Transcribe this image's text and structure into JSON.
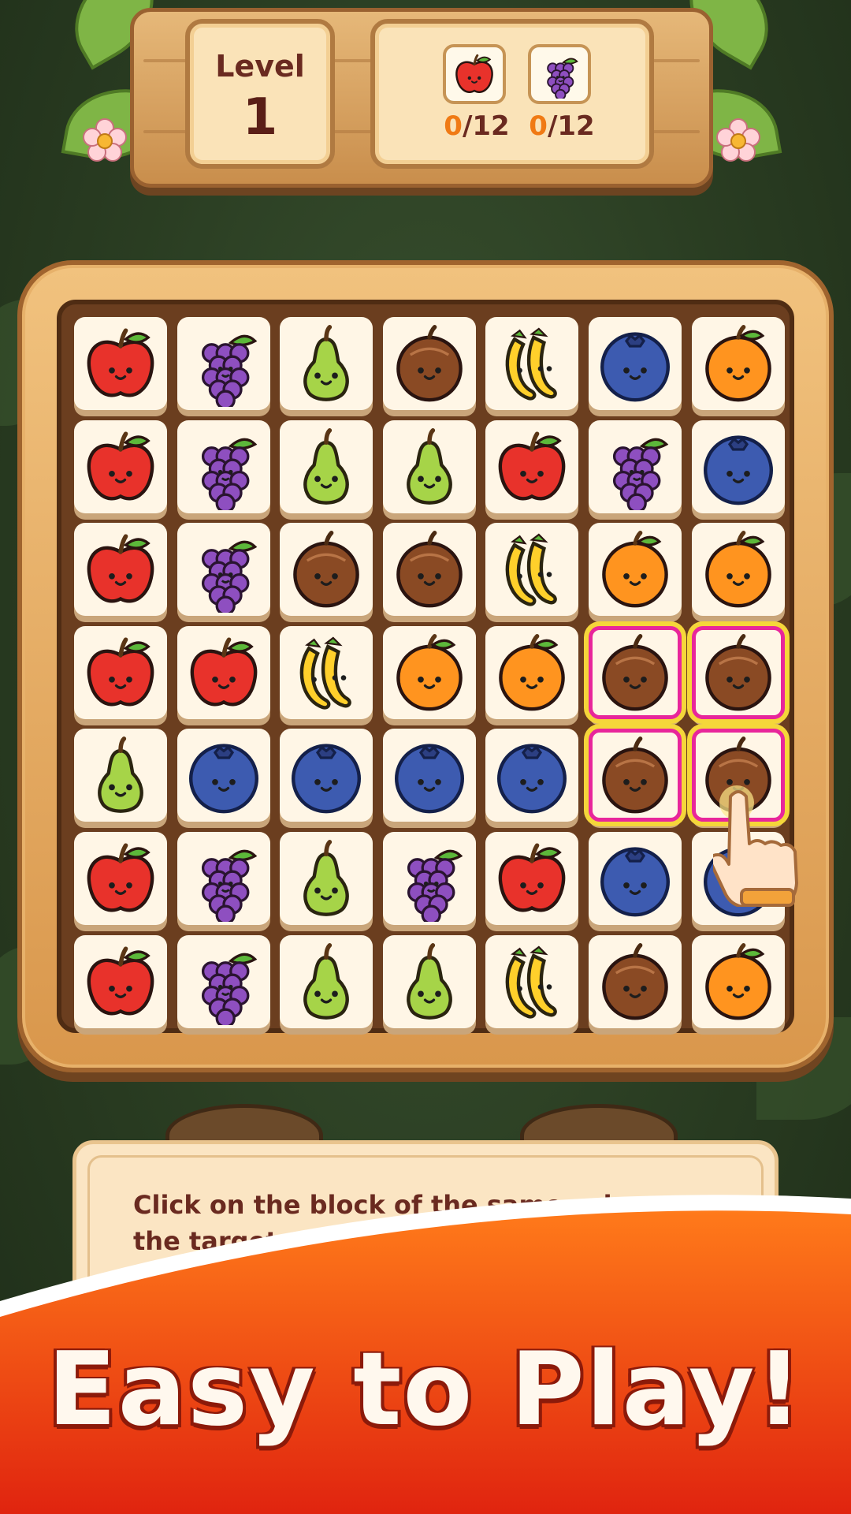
{
  "header": {
    "level_label": "Level",
    "level_number": "1",
    "goals": [
      {
        "fruit": "apple",
        "icon": "apple-icon",
        "collected": "0",
        "target": "/12"
      },
      {
        "fruit": "grape",
        "icon": "grape-icon",
        "collected": "0",
        "target": "/12"
      }
    ]
  },
  "board": {
    "rows": [
      [
        "apple",
        "grape",
        "pear",
        "coconut",
        "banana",
        "blueberry",
        "orange"
      ],
      [
        "apple",
        "grape",
        "pear",
        "pear",
        "apple",
        "grape",
        "blueberry"
      ],
      [
        "apple",
        "grape",
        "coconut",
        "coconut",
        "banana",
        "orange",
        "orange"
      ],
      [
        "apple",
        "apple",
        "banana",
        "orange",
        "orange",
        "coconut",
        "coconut"
      ],
      [
        "pear",
        "blueberry",
        "blueberry",
        "blueberry",
        "blueberry",
        "coconut",
        "coconut"
      ],
      [
        "apple",
        "grape",
        "pear",
        "grape",
        "apple",
        "blueberry",
        "blueberry"
      ],
      [
        "apple",
        "grape",
        "pear",
        "pear",
        "banana",
        "coconut",
        "orange"
      ]
    ],
    "selected": [
      [
        3,
        5
      ],
      [
        3,
        6
      ],
      [
        4,
        5
      ],
      [
        4,
        6
      ]
    ],
    "pointer_icon": "hand-pointer-icon"
  },
  "tip": {
    "text": "Click on the block of the same color as the target, elimi"
  },
  "banner": {
    "title": "Easy to Play!"
  },
  "colors": {
    "banner_top": "#ff7a1a",
    "banner_bottom": "#e0240f",
    "selection": "#e8269b",
    "selection_glow": "#f5d63a",
    "goal_count": "#f07a14"
  }
}
